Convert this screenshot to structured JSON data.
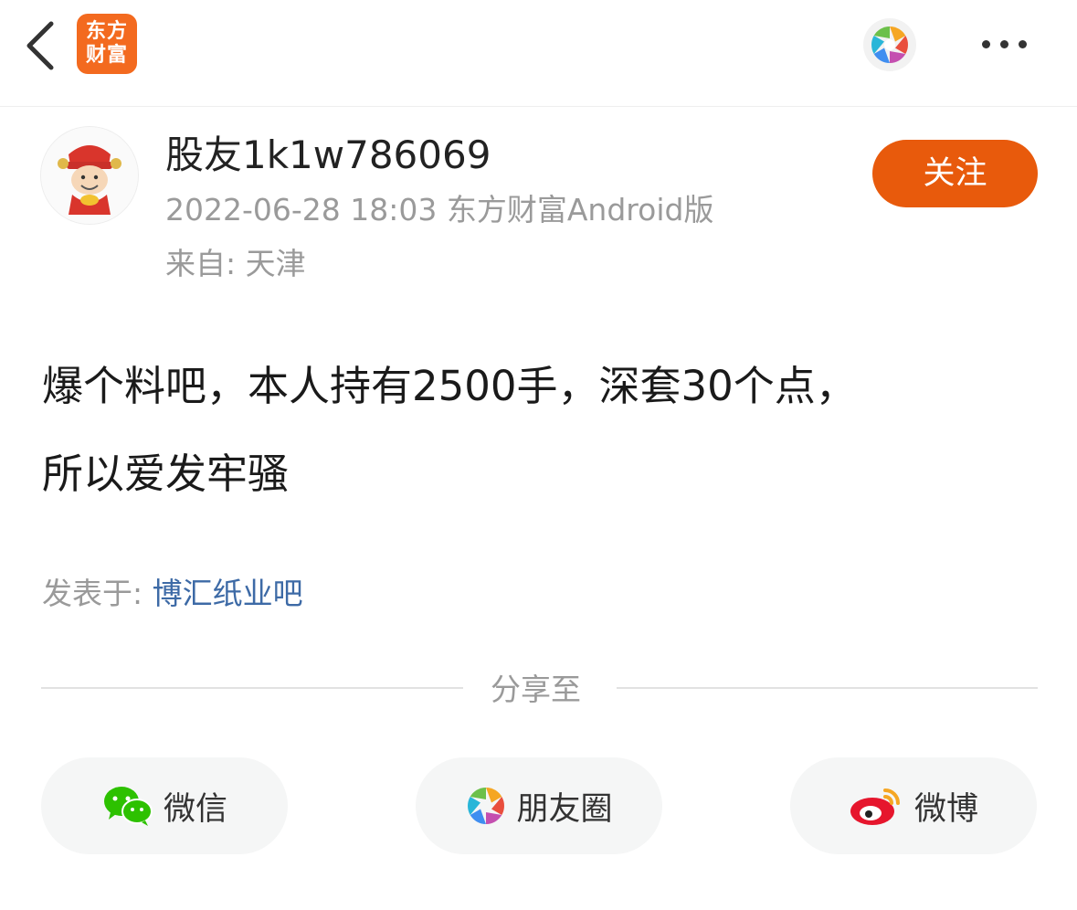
{
  "header": {
    "logo_line1": "东方",
    "logo_line2": "财富"
  },
  "post": {
    "username": "股友1k1w786069",
    "meta": "2022-06-28 18:03 东方财富Android版",
    "location": "来自: 天津",
    "follow_label": "关注",
    "content_line1": "爆个料吧，本人持有2500手，深套30个点，",
    "content_line2": "所以爱发牢骚",
    "posted_in_label": "发表于: ",
    "forum_name": "博汇纸业吧"
  },
  "share": {
    "title": "分享至",
    "wechat": "微信",
    "moments": "朋友圈",
    "weibo": "微博"
  },
  "colors": {
    "brand": "#f36a1f",
    "follow_button": "#e85a0c",
    "link": "#3d6aa6",
    "wechat_green": "#2dc100",
    "weibo_red": "#e6162d"
  },
  "icons": [
    "back-arrow-icon",
    "moments-aperture-icon",
    "more-dots-icon",
    "wechat-icon",
    "moments-icon",
    "weibo-icon"
  ]
}
